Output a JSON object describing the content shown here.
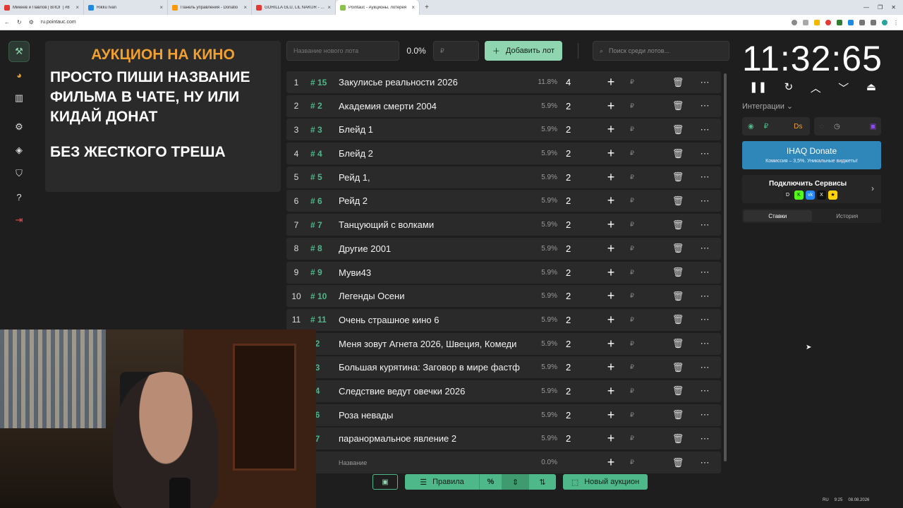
{
  "browser": {
    "tabs": [
      {
        "title": "Микеев и Павлов | ВЛОГ | #8",
        "color": "#e53935",
        "active": false
      },
      {
        "title": "Rikku Ivan",
        "color": "#1e88e5",
        "active": false
      },
      {
        "title": "Панель управления - Donatio",
        "color": "#ff9800",
        "active": false
      },
      {
        "title": "GORILLA GLU, LIL NAKUR - Sc",
        "color": "#e53935",
        "active": false
      },
      {
        "title": "Pointauc - Аукционы, лотерея",
        "color": "#8bc34a",
        "active": true
      }
    ],
    "url": "ru.pointauc.com"
  },
  "banner": {
    "title": "АУКЦИОН НА КИНО",
    "line1": "ПРОСТО ПИШИ НАЗВАНИЕ",
    "line2": "ФИЛЬМА В ЧАТЕ, НУ ИЛИ",
    "line3": "КИДАЙ ДОНАТ",
    "line4": "БЕЗ ЖЕСТКОГО ТРЕША"
  },
  "form": {
    "name_placeholder": "Название нового лота",
    "percent": "0.0%",
    "currency": "₽",
    "add_label": "Добавить лот",
    "search_placeholder": "Поиск среди лотов..."
  },
  "lots": [
    {
      "idx": "1",
      "id": "# 15",
      "name": "Закулисье реальности 2026",
      "pct": "11.8%",
      "amount": "4"
    },
    {
      "idx": "2",
      "id": "# 2",
      "name": "Академия смерти 2004",
      "pct": "5.9%",
      "amount": "2"
    },
    {
      "idx": "3",
      "id": "# 3",
      "name": "Блейд 1",
      "pct": "5.9%",
      "amount": "2"
    },
    {
      "idx": "4",
      "id": "# 4",
      "name": "Блейд 2",
      "pct": "5.9%",
      "amount": "2"
    },
    {
      "idx": "5",
      "id": "# 5",
      "name": "Рейд 1,",
      "pct": "5.9%",
      "amount": "2"
    },
    {
      "idx": "6",
      "id": "# 6",
      "name": "Рейд 2",
      "pct": "5.9%",
      "amount": "2"
    },
    {
      "idx": "7",
      "id": "# 7",
      "name": "Танцующий с волками",
      "pct": "5.9%",
      "amount": "2"
    },
    {
      "idx": "8",
      "id": "# 8",
      "name": "Другие 2001",
      "pct": "5.9%",
      "amount": "2"
    },
    {
      "idx": "9",
      "id": "# 9",
      "name": " Муви43",
      "pct": "5.9%",
      "amount": "2"
    },
    {
      "idx": "10",
      "id": "# 10",
      "name": "Легенды Осени",
      "pct": "5.9%",
      "amount": "2"
    },
    {
      "idx": "11",
      "id": "# 11",
      "name": " Очень страшное кино 6",
      "pct": "5.9%",
      "amount": "2"
    },
    {
      "idx": "",
      "id": "12",
      "name": " Меня зовут Агнета 2026, Швеция, Комеди",
      "pct": "5.9%",
      "amount": "2"
    },
    {
      "idx": "",
      "id": "13",
      "name": " Большая курятина: Заговор в мире фастф",
      "pct": "5.9%",
      "amount": "2"
    },
    {
      "idx": "",
      "id": "14",
      "name": "Следствие ведут овечки 2026",
      "pct": "5.9%",
      "amount": "2"
    },
    {
      "idx": "",
      "id": "16",
      "name": "Роза невады",
      "pct": "5.9%",
      "amount": "2"
    },
    {
      "idx": "",
      "id": "17",
      "name": "паранормальное явление 2",
      "pct": "5.9%",
      "amount": "2"
    }
  ],
  "new_row": {
    "id": "1",
    "name": "Название",
    "pct": "0.0%",
    "currency": "₽"
  },
  "row_currency": "₽",
  "toolbar": {
    "rules_label": "Правила",
    "percent_label": "%",
    "new_auction_label": "Новый аукцион"
  },
  "timer": {
    "value": "11:32:65"
  },
  "integrations": {
    "label": "Интеграции",
    "ruble": "₽"
  },
  "donate": {
    "title": "IHAQ Donate",
    "subtitle": "Комиссия – 3,5%. Уникальные виджеты!"
  },
  "services": {
    "title": "Подключить Сервисы"
  },
  "bets_tabs": {
    "bets": "Ставки",
    "history": "История"
  },
  "tray": {
    "lang": "RU",
    "time": "9:25",
    "date": "08.08.2026"
  }
}
